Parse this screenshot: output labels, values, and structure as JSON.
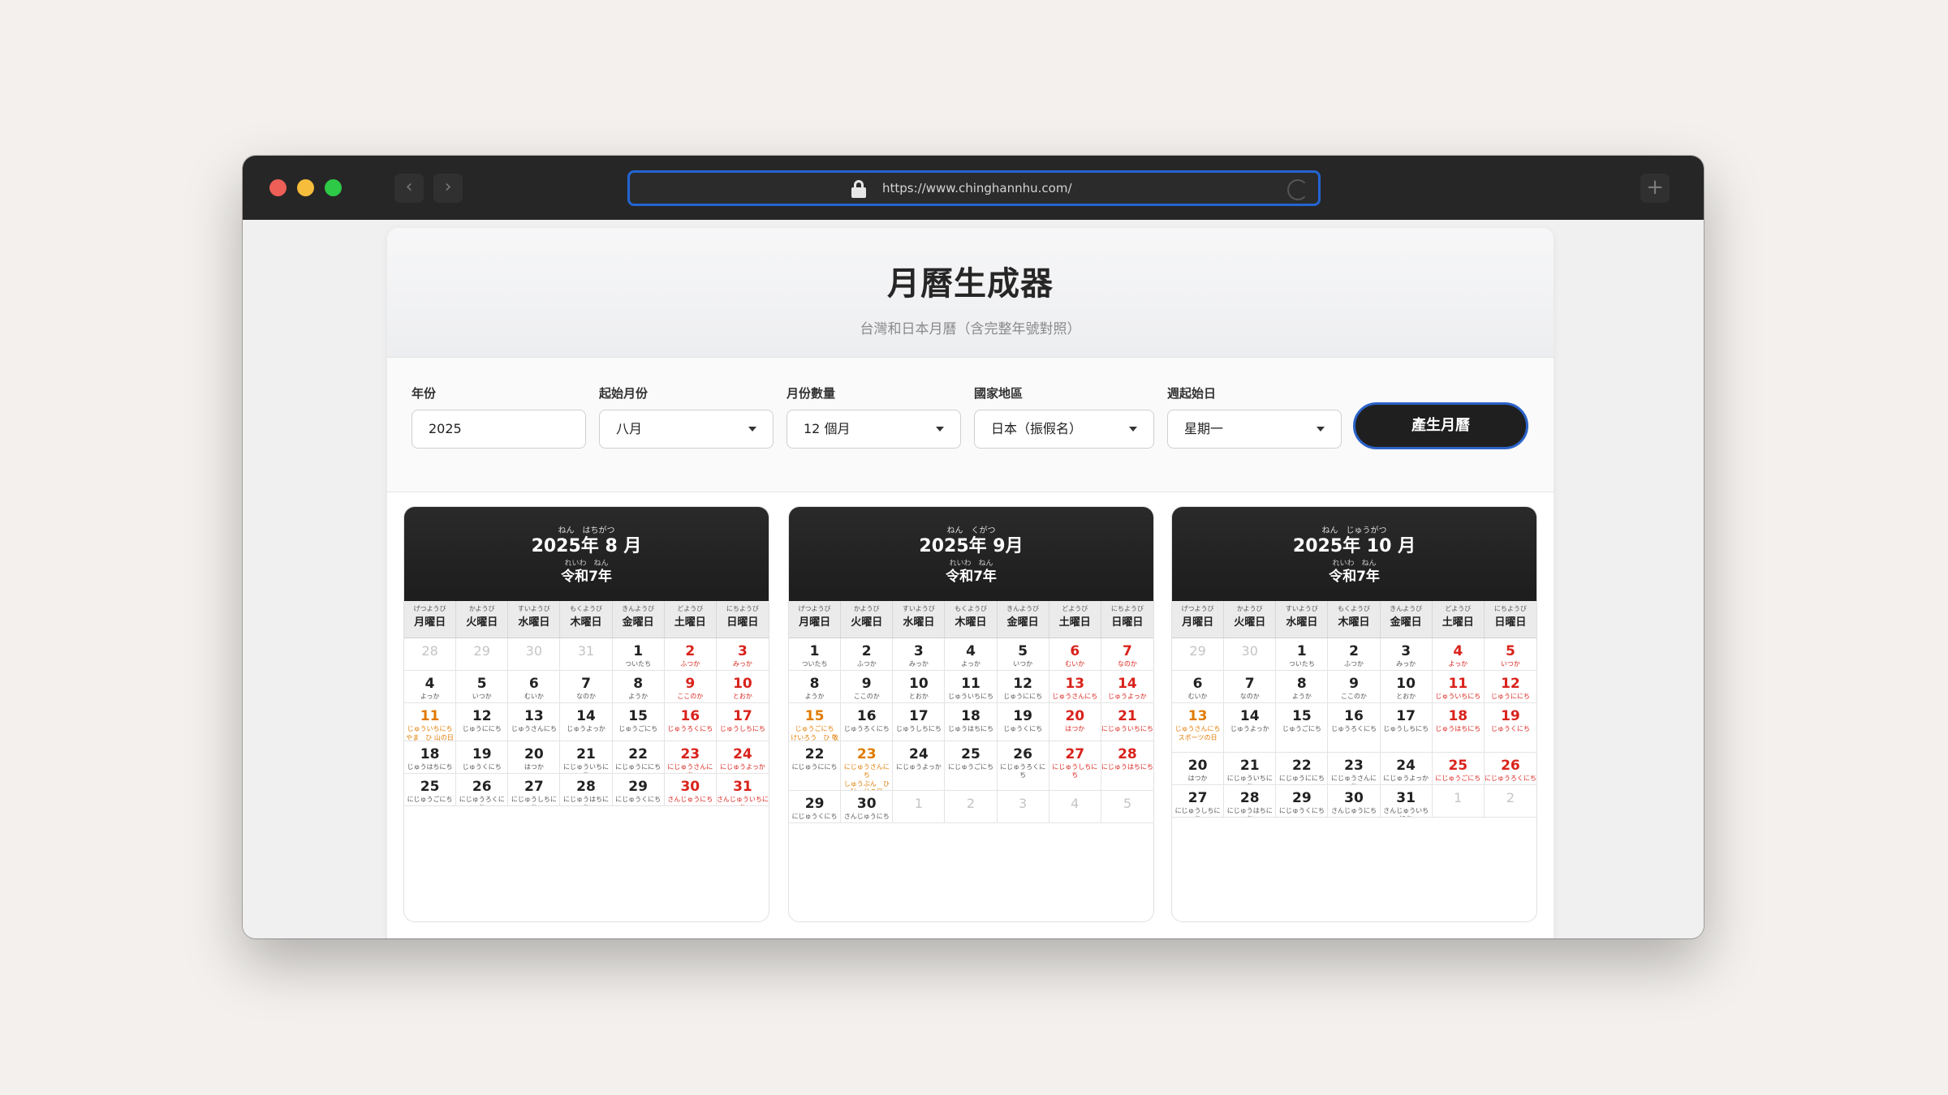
{
  "browser": {
    "url": "https://www.chinghannhu.com/",
    "back_icon": "‹",
    "forward_icon": "›",
    "new_tab_icon": "+"
  },
  "app": {
    "title": "月曆生成器",
    "subtitle": "台灣和日本月曆（含完整年號對照）"
  },
  "controls": {
    "year": {
      "label": "年份",
      "value": "2025"
    },
    "start_month": {
      "label": "起始月份",
      "value": "八月"
    },
    "month_count": {
      "label": "月份數量",
      "value": "12 個月"
    },
    "region": {
      "label": "國家地區",
      "value": "日本（振假名）"
    },
    "week_start": {
      "label": "週起始日",
      "value": "星期一"
    },
    "generate_label": "產生月曆"
  },
  "weekdays": [
    {
      "ruby": "げつようび",
      "name": "月曜日"
    },
    {
      "ruby": "かようび",
      "name": "火曜日"
    },
    {
      "ruby": "すいようび",
      "name": "水曜日"
    },
    {
      "ruby": "もくようび",
      "name": "木曜日"
    },
    {
      "ruby": "きんようび",
      "name": "金曜日"
    },
    {
      "ruby": "どようび",
      "name": "土曜日"
    },
    {
      "ruby": "にちようび",
      "name": "日曜日"
    }
  ],
  "months": [
    {
      "title_ruby": "ねん　はちがつ",
      "title": "2025年 8 月",
      "era_ruby": "れいわ　ねん",
      "era": "令和7年",
      "weeks": [
        [
          {
            "d": "28",
            "t": "other"
          },
          {
            "d": "29",
            "t": "other"
          },
          {
            "d": "30",
            "t": "other"
          },
          {
            "d": "31",
            "t": "other"
          },
          {
            "d": "1",
            "k": "ついたち"
          },
          {
            "d": "2",
            "k": "ふつか",
            "t": "red"
          },
          {
            "d": "3",
            "k": "みっか",
            "t": "red"
          }
        ],
        [
          {
            "d": "4",
            "k": "よっか"
          },
          {
            "d": "5",
            "k": "いつか"
          },
          {
            "d": "6",
            "k": "むいか"
          },
          {
            "d": "7",
            "k": "なのか"
          },
          {
            "d": "8",
            "k": "ようか"
          },
          {
            "d": "9",
            "k": "ここのか",
            "t": "red"
          },
          {
            "d": "10",
            "k": "とおか",
            "t": "red"
          }
        ],
        [
          {
            "d": "11",
            "k": "じゅういちにち",
            "t": "hol",
            "h": "やま　ひ 山の日"
          },
          {
            "d": "12",
            "k": "じゅうににち"
          },
          {
            "d": "13",
            "k": "じゅうさんにち"
          },
          {
            "d": "14",
            "k": "じゅうよっか"
          },
          {
            "d": "15",
            "k": "じゅうごにち"
          },
          {
            "d": "16",
            "k": "じゅうろくにち",
            "t": "red"
          },
          {
            "d": "17",
            "k": "じゅうしちにち",
            "t": "red"
          }
        ],
        [
          {
            "d": "18",
            "k": "じゅうはちにち"
          },
          {
            "d": "19",
            "k": "じゅうくにち"
          },
          {
            "d": "20",
            "k": "はつか"
          },
          {
            "d": "21",
            "k": "にじゅういちにち"
          },
          {
            "d": "22",
            "k": "にじゅうににち"
          },
          {
            "d": "23",
            "k": "にじゅうさんにち",
            "t": "red"
          },
          {
            "d": "24",
            "k": "にじゅうよっか",
            "t": "red"
          }
        ],
        [
          {
            "d": "25",
            "k": "にじゅうごにち"
          },
          {
            "d": "26",
            "k": "にじゅうろくにち"
          },
          {
            "d": "27",
            "k": "にじゅうしちにち"
          },
          {
            "d": "28",
            "k": "にじゅうはちにち"
          },
          {
            "d": "29",
            "k": "にじゅうくにち"
          },
          {
            "d": "30",
            "k": "さんじゅうにち",
            "t": "red"
          },
          {
            "d": "31",
            "k": "さんじゅういちにち",
            "t": "red"
          }
        ]
      ]
    },
    {
      "title_ruby": "ねん　くがつ",
      "title": "2025年 9月",
      "era_ruby": "れいわ　ねん",
      "era": "令和7年",
      "weeks": [
        [
          {
            "d": "1",
            "k": "ついたち"
          },
          {
            "d": "2",
            "k": "ふつか"
          },
          {
            "d": "3",
            "k": "みっか"
          },
          {
            "d": "4",
            "k": "よっか"
          },
          {
            "d": "5",
            "k": "いつか"
          },
          {
            "d": "6",
            "k": "むいか",
            "t": "red"
          },
          {
            "d": "7",
            "k": "なのか",
            "t": "red"
          }
        ],
        [
          {
            "d": "8",
            "k": "ようか"
          },
          {
            "d": "9",
            "k": "ここのか"
          },
          {
            "d": "10",
            "k": "とおか"
          },
          {
            "d": "11",
            "k": "じゅういちにち"
          },
          {
            "d": "12",
            "k": "じゅうににち"
          },
          {
            "d": "13",
            "k": "じゅうさんにち",
            "t": "red"
          },
          {
            "d": "14",
            "k": "じゅうよっか",
            "t": "red"
          }
        ],
        [
          {
            "d": "15",
            "k": "じゅうごにち",
            "t": "hol",
            "h": "けいろう　ひ 敬　老の日"
          },
          {
            "d": "16",
            "k": "じゅうろくにち"
          },
          {
            "d": "17",
            "k": "じゅうしちにち"
          },
          {
            "d": "18",
            "k": "じゅうはちにち"
          },
          {
            "d": "19",
            "k": "じゅうくにち"
          },
          {
            "d": "20",
            "k": "はつか",
            "t": "red"
          },
          {
            "d": "21",
            "k": "にじゅういちにち",
            "t": "red"
          }
        ],
        [
          {
            "d": "22",
            "k": "にじゅうににち"
          },
          {
            "d": "23",
            "k": "にじゅうさんにち",
            "t": "hol",
            "h": "しゅうぶん　ひ 秋　分の日"
          },
          {
            "d": "24",
            "k": "にじゅうよっか"
          },
          {
            "d": "25",
            "k": "にじゅうごにち"
          },
          {
            "d": "26",
            "k": "にじゅうろくにち"
          },
          {
            "d": "27",
            "k": "にじゅうしちにち",
            "t": "red"
          },
          {
            "d": "28",
            "k": "にじゅうはちにち",
            "t": "red"
          }
        ],
        [
          {
            "d": "29",
            "k": "にじゅうくにち"
          },
          {
            "d": "30",
            "k": "さんじゅうにち"
          },
          {
            "d": "1",
            "t": "other"
          },
          {
            "d": "2",
            "t": "other"
          },
          {
            "d": "3",
            "t": "other"
          },
          {
            "d": "4",
            "t": "other"
          },
          {
            "d": "5",
            "t": "other"
          }
        ]
      ]
    },
    {
      "title_ruby": "ねん　じゅうがつ",
      "title": "2025年 10 月",
      "era_ruby": "れいわ　ねん",
      "era": "令和7年",
      "weeks": [
        [
          {
            "d": "29",
            "t": "other"
          },
          {
            "d": "30",
            "t": "other"
          },
          {
            "d": "1",
            "k": "ついたち"
          },
          {
            "d": "2",
            "k": "ふつか"
          },
          {
            "d": "3",
            "k": "みっか"
          },
          {
            "d": "4",
            "k": "よっか",
            "t": "red"
          },
          {
            "d": "5",
            "k": "いつか",
            "t": "red"
          }
        ],
        [
          {
            "d": "6",
            "k": "むいか"
          },
          {
            "d": "7",
            "k": "なのか"
          },
          {
            "d": "8",
            "k": "ようか"
          },
          {
            "d": "9",
            "k": "ここのか"
          },
          {
            "d": "10",
            "k": "とおか"
          },
          {
            "d": "11",
            "k": "じゅういちにち",
            "t": "red"
          },
          {
            "d": "12",
            "k": "じゅうににち",
            "t": "red"
          }
        ],
        [
          {
            "d": "13",
            "k": "じゅうさんにち",
            "t": "hol",
            "h": "スポーツの日"
          },
          {
            "d": "14",
            "k": "じゅうよっか"
          },
          {
            "d": "15",
            "k": "じゅうごにち"
          },
          {
            "d": "16",
            "k": "じゅうろくにち"
          },
          {
            "d": "17",
            "k": "じゅうしちにち"
          },
          {
            "d": "18",
            "k": "じゅうはちにち",
            "t": "red"
          },
          {
            "d": "19",
            "k": "じゅうくにち",
            "t": "red"
          }
        ],
        [
          {
            "d": "20",
            "k": "はつか"
          },
          {
            "d": "21",
            "k": "にじゅういちにち"
          },
          {
            "d": "22",
            "k": "にじゅうににち"
          },
          {
            "d": "23",
            "k": "にじゅうさんにち"
          },
          {
            "d": "24",
            "k": "にじゅうよっか"
          },
          {
            "d": "25",
            "k": "にじゅうごにち",
            "t": "red"
          },
          {
            "d": "26",
            "k": "にじゅうろくにち",
            "t": "red"
          }
        ],
        [
          {
            "d": "27",
            "k": "にじゅうしちにち"
          },
          {
            "d": "28",
            "k": "にじゅうはちにち"
          },
          {
            "d": "29",
            "k": "にじゅうくにち"
          },
          {
            "d": "30",
            "k": "さんじゅうにち"
          },
          {
            "d": "31",
            "k": "さんじゅういちにち"
          },
          {
            "d": "1",
            "t": "other"
          },
          {
            "d": "2",
            "t": "other"
          }
        ]
      ]
    }
  ]
}
